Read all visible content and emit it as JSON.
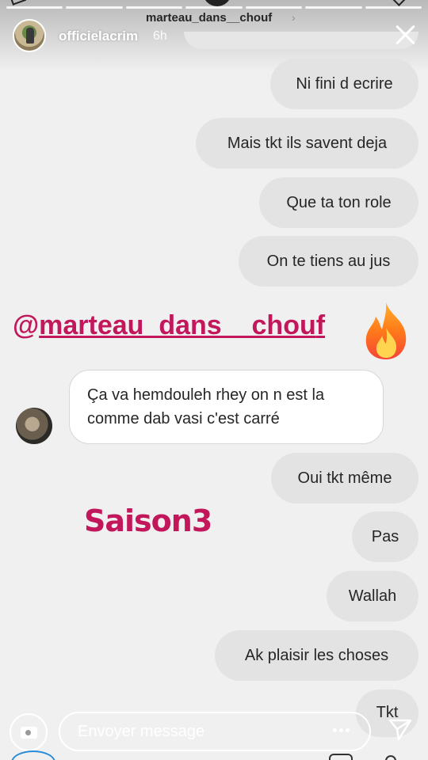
{
  "story": {
    "username": "officielacrim",
    "time_ago": "6h",
    "mentioned_account": "marteau_dans__chouf"
  },
  "messages": {
    "sent": [
      "Ni fini d ecrire",
      "Mais tkt ils savent deja",
      "Que ta ton role",
      "On te tiens au jus",
      "Oui tkt même",
      "Pas",
      "Wallah",
      "Ak plaisir les choses",
      "Tkt"
    ],
    "received": "Ça va hemdouleh rhey on n est la comme dab vasi c'est carré"
  },
  "stickers": {
    "mention_prefix": "@",
    "mention_handle": "marteau_dans__chou",
    "mention_tail": "f",
    "saison_text": "Saison3"
  },
  "reply": {
    "placeholder": "Envoyer message"
  },
  "icons": {
    "close": "close-icon",
    "camera": "camera-icon",
    "more": "more-icon",
    "send": "send-icon",
    "fire": "fire-icon"
  },
  "colors": {
    "sticker_magenta": "#c2185b",
    "sent_bubble": "#e3e3e3",
    "received_bubble": "#ffffff"
  }
}
